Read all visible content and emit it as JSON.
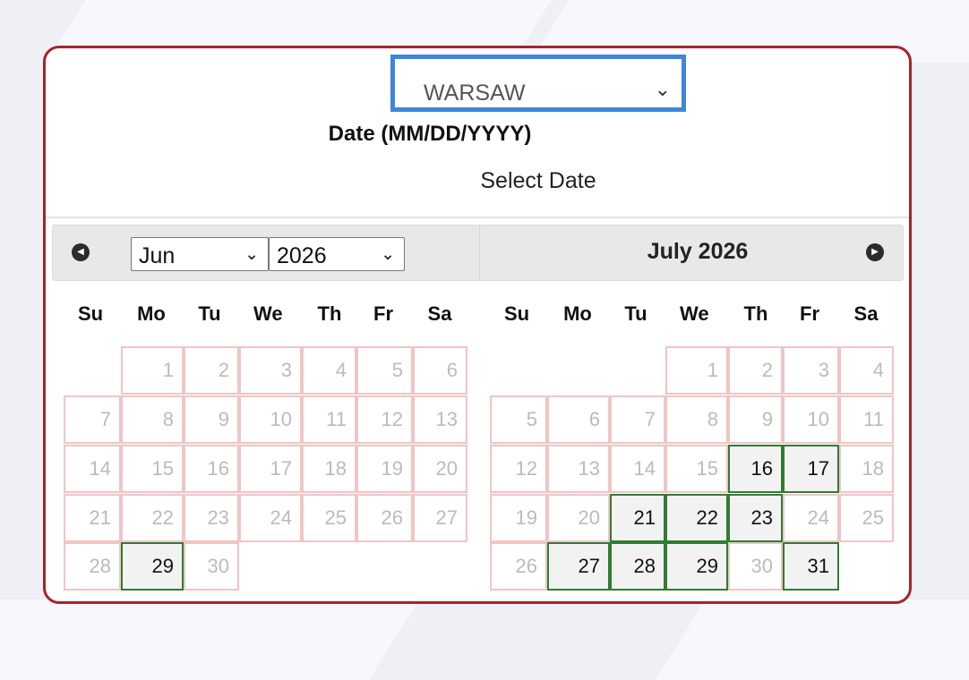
{
  "city_select": {
    "value": "WARSAW"
  },
  "date_label": "Date (MM/DD/YYYY)",
  "date_placeholder": "Select Date",
  "datepicker": {
    "month_select_value": "Jun",
    "year_select_value": "2026",
    "second_month_title": "July 2026",
    "weekdays": [
      "Su",
      "Mo",
      "Tu",
      "We",
      "Th",
      "Fr",
      "Sa"
    ],
    "months": [
      {
        "first_weekday": 1,
        "days_in_month": 30,
        "available_days": [
          29
        ]
      },
      {
        "first_weekday": 3,
        "days_in_month": 31,
        "available_days": [
          16,
          17,
          21,
          22,
          23,
          27,
          28,
          29,
          31
        ]
      }
    ]
  },
  "colors": {
    "card_border": "#a6222e",
    "select_focus": "#3f86d9",
    "available_border": "#2e7d32",
    "unavailable_border": "#f2c4c4"
  }
}
